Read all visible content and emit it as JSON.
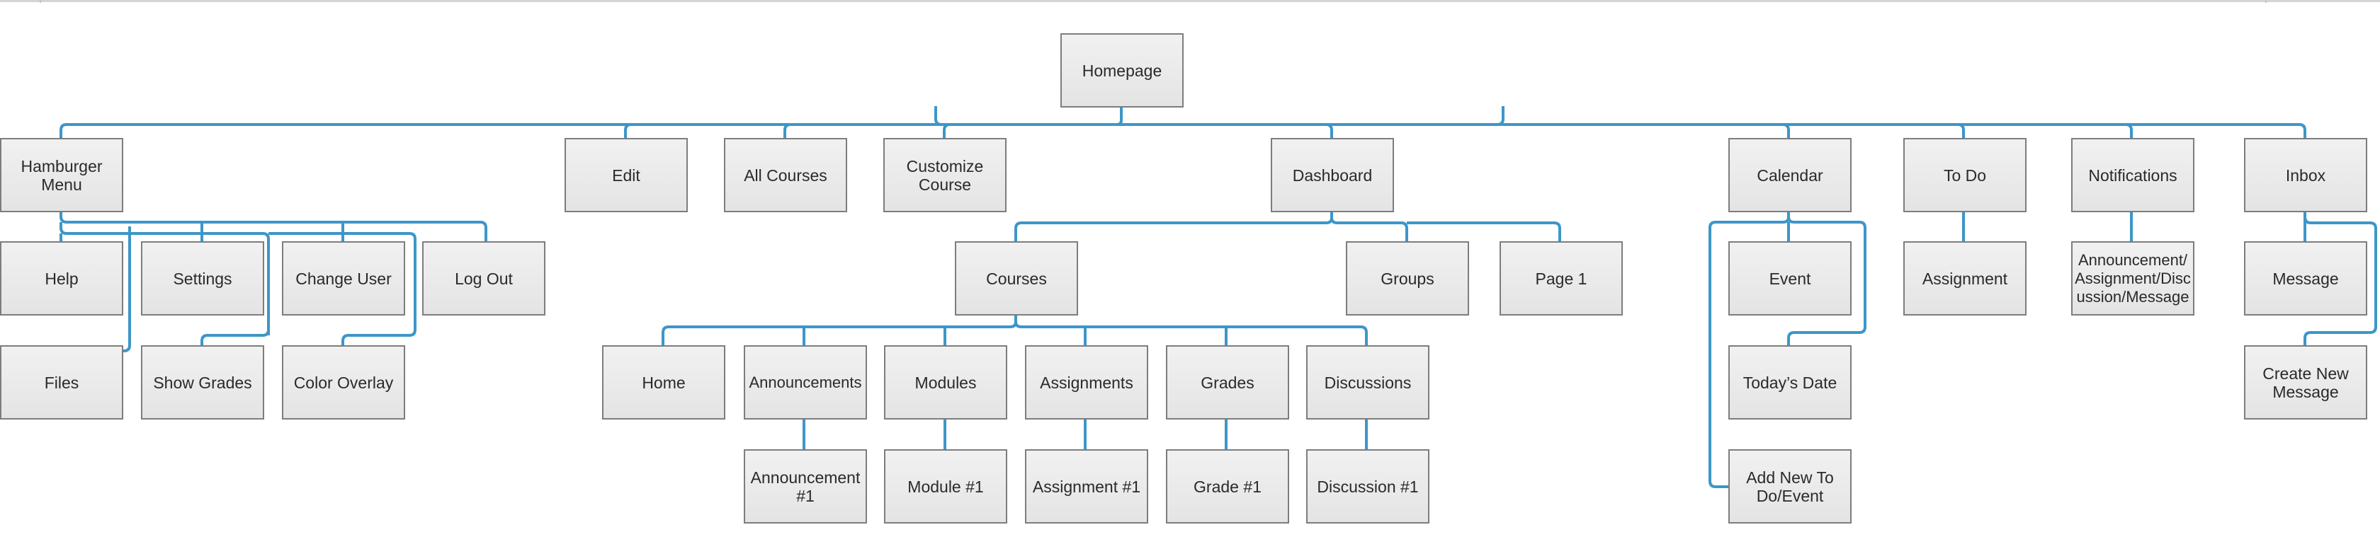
{
  "diagram": {
    "type": "sitemap-tree",
    "root": "Homepage",
    "colors": {
      "connector": "#3d96c8",
      "node_border": "#7d7d7d",
      "node_fill_top": "#f1f1f1",
      "node_fill_bottom": "#e4e4e4",
      "text": "#2a2a2a"
    },
    "nodes": {
      "homepage": "Homepage",
      "hamburger_menu": "Hamburger Menu",
      "edit": "Edit",
      "all_courses": "All Courses",
      "customize_course": "Customize Course",
      "dashboard": "Dashboard",
      "calendar": "Calendar",
      "to_do": "To Do",
      "notifications": "Notifications",
      "inbox": "Inbox",
      "help": "Help",
      "settings": "Settings",
      "change_user": "Change User",
      "log_out": "Log Out",
      "files": "Files",
      "show_grades": "Show Grades",
      "color_overlay": "Color Overlay",
      "courses": "Courses",
      "groups": "Groups",
      "page_1": "Page 1",
      "home": "Home",
      "announcements": "Announcements",
      "modules": "Modules",
      "assignments": "Assignments",
      "grades": "Grades",
      "discussions": "Discussions",
      "announcement_1": "Announcement #1",
      "module_1": "Module #1",
      "assignment_1": "Assignment #1",
      "grade_1": "Grade #1",
      "discussion_1": "Discussion #1",
      "event": "Event",
      "todays_date": "Today’s Date",
      "add_new_todo_event": "Add New To Do/Event",
      "todo_assignment": "Assignment",
      "notif_item": "Announcement/Assignment/Discussion/Message",
      "message": "Message",
      "create_new_message": "Create New Message"
    },
    "edges": [
      [
        "homepage",
        "hamburger_menu"
      ],
      [
        "homepage",
        "edit"
      ],
      [
        "homepage",
        "all_courses"
      ],
      [
        "homepage",
        "customize_course"
      ],
      [
        "homepage",
        "dashboard"
      ],
      [
        "homepage",
        "calendar"
      ],
      [
        "homepage",
        "to_do"
      ],
      [
        "homepage",
        "notifications"
      ],
      [
        "homepage",
        "inbox"
      ],
      [
        "hamburger_menu",
        "help"
      ],
      [
        "hamburger_menu",
        "settings"
      ],
      [
        "hamburger_menu",
        "change_user"
      ],
      [
        "hamburger_menu",
        "log_out"
      ],
      [
        "hamburger_menu",
        "files"
      ],
      [
        "hamburger_menu",
        "show_grades"
      ],
      [
        "hamburger_menu",
        "color_overlay"
      ],
      [
        "dashboard",
        "courses"
      ],
      [
        "dashboard",
        "groups"
      ],
      [
        "dashboard",
        "page_1"
      ],
      [
        "courses",
        "home"
      ],
      [
        "courses",
        "announcements"
      ],
      [
        "courses",
        "modules"
      ],
      [
        "courses",
        "assignments"
      ],
      [
        "courses",
        "grades"
      ],
      [
        "courses",
        "discussions"
      ],
      [
        "announcements",
        "announcement_1"
      ],
      [
        "modules",
        "module_1"
      ],
      [
        "assignments",
        "assignment_1"
      ],
      [
        "grades",
        "grade_1"
      ],
      [
        "discussions",
        "discussion_1"
      ],
      [
        "calendar",
        "event"
      ],
      [
        "calendar",
        "todays_date"
      ],
      [
        "calendar",
        "add_new_todo_event"
      ],
      [
        "to_do",
        "todo_assignment"
      ],
      [
        "notifications",
        "notif_item"
      ],
      [
        "inbox",
        "message"
      ],
      [
        "inbox",
        "create_new_message"
      ]
    ]
  }
}
